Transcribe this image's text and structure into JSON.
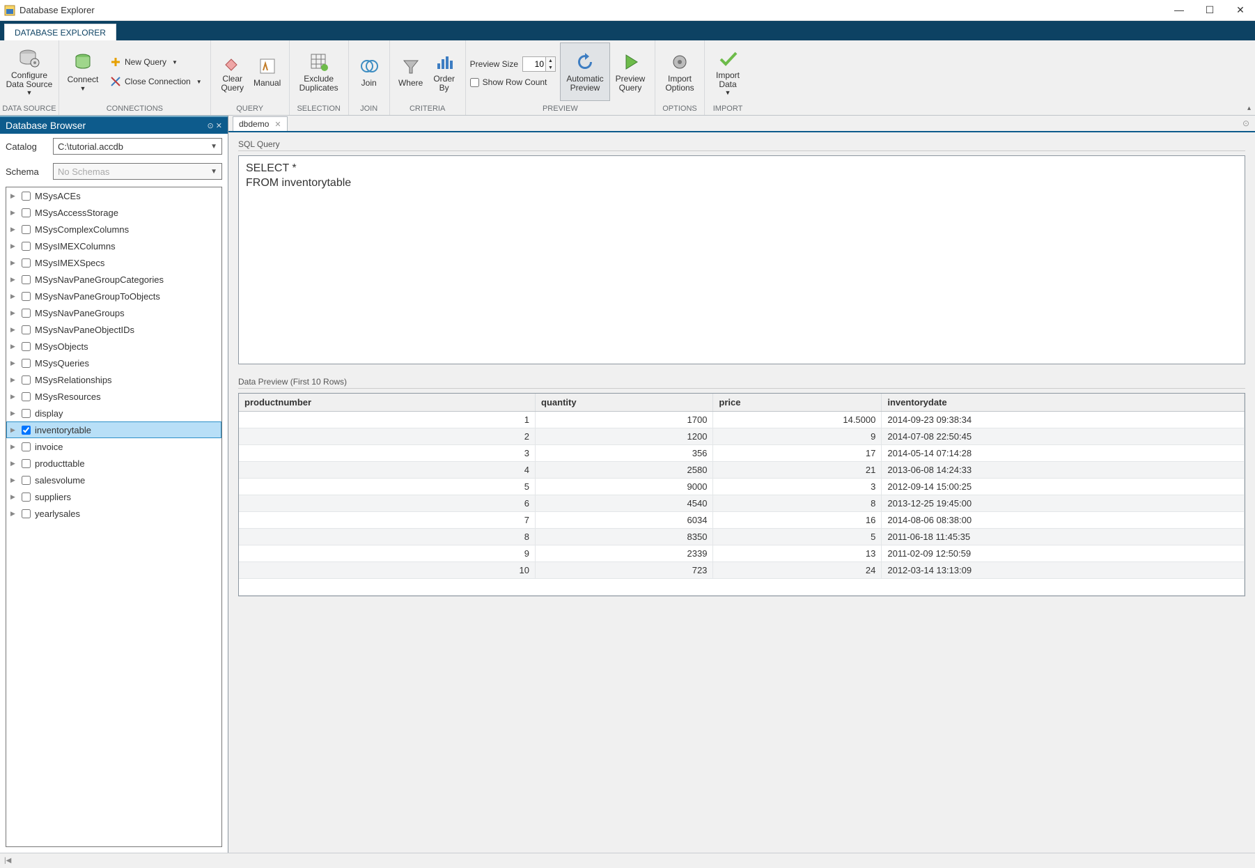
{
  "window": {
    "title": "Database Explorer"
  },
  "top_tab": {
    "label": "DATABASE EXPLORER"
  },
  "ribbon": {
    "groups": {
      "data_source": {
        "label": "DATA SOURCE",
        "configure": "Configure\nData Source"
      },
      "connections": {
        "label": "CONNECTIONS",
        "connect": "Connect",
        "new_query": "New Query",
        "close_conn": "Close Connection"
      },
      "query": {
        "label": "QUERY",
        "clear": "Clear\nQuery",
        "manual": "Manual"
      },
      "selection": {
        "label": "SELECTION",
        "exclude": "Exclude\nDuplicates"
      },
      "join": {
        "label": "JOIN",
        "join": "Join"
      },
      "criteria": {
        "label": "CRITERIA",
        "where": "Where",
        "orderby": "Order\nBy"
      },
      "preview": {
        "label": "PREVIEW",
        "size_label": "Preview Size",
        "size_value": "10",
        "row_count": "Show Row Count",
        "auto": "Automatic\nPreview",
        "preview_q": "Preview\nQuery"
      },
      "options": {
        "label": "OPTIONS",
        "import_opts": "Import\nOptions"
      },
      "import": {
        "label": "IMPORT",
        "import_data": "Import\nData"
      }
    }
  },
  "browser": {
    "title": "Database Browser",
    "catalog_label": "Catalog",
    "catalog_value": "C:\\tutorial.accdb",
    "schema_label": "Schema",
    "schema_placeholder": "No Schemas",
    "items": [
      {
        "label": "MSysACEs",
        "checked": false
      },
      {
        "label": "MSysAccessStorage",
        "checked": false
      },
      {
        "label": "MSysComplexColumns",
        "checked": false
      },
      {
        "label": "MSysIMEXColumns",
        "checked": false
      },
      {
        "label": "MSysIMEXSpecs",
        "checked": false
      },
      {
        "label": "MSysNavPaneGroupCategories",
        "checked": false
      },
      {
        "label": "MSysNavPaneGroupToObjects",
        "checked": false
      },
      {
        "label": "MSysNavPaneGroups",
        "checked": false
      },
      {
        "label": "MSysNavPaneObjectIDs",
        "checked": false
      },
      {
        "label": "MSysObjects",
        "checked": false
      },
      {
        "label": "MSysQueries",
        "checked": false
      },
      {
        "label": "MSysRelationships",
        "checked": false
      },
      {
        "label": "MSysResources",
        "checked": false
      },
      {
        "label": "display",
        "checked": false
      },
      {
        "label": "inventorytable",
        "checked": true,
        "selected": true
      },
      {
        "label": "invoice",
        "checked": false
      },
      {
        "label": "producttable",
        "checked": false
      },
      {
        "label": "salesvolume",
        "checked": false
      },
      {
        "label": "suppliers",
        "checked": false
      },
      {
        "label": "yearlysales",
        "checked": false
      }
    ]
  },
  "document": {
    "tab_label": "dbdemo",
    "sql_label": "SQL Query",
    "sql_text": "SELECT *\nFROM inventorytable",
    "preview_label": "Data Preview (First 10 Rows)",
    "columns": [
      "productnumber",
      "quantity",
      "price",
      "inventorydate"
    ],
    "rows": [
      {
        "productnumber": "1",
        "quantity": "1700",
        "price": "14.5000",
        "inventorydate": "2014-09-23 09:38:34"
      },
      {
        "productnumber": "2",
        "quantity": "1200",
        "price": "9",
        "inventorydate": "2014-07-08 22:50:45"
      },
      {
        "productnumber": "3",
        "quantity": "356",
        "price": "17",
        "inventorydate": "2014-05-14 07:14:28"
      },
      {
        "productnumber": "4",
        "quantity": "2580",
        "price": "21",
        "inventorydate": "2013-06-08 14:24:33"
      },
      {
        "productnumber": "5",
        "quantity": "9000",
        "price": "3",
        "inventorydate": "2012-09-14 15:00:25"
      },
      {
        "productnumber": "6",
        "quantity": "4540",
        "price": "8",
        "inventorydate": "2013-12-25 19:45:00"
      },
      {
        "productnumber": "7",
        "quantity": "6034",
        "price": "16",
        "inventorydate": "2014-08-06 08:38:00"
      },
      {
        "productnumber": "8",
        "quantity": "8350",
        "price": "5",
        "inventorydate": "2011-06-18 11:45:35"
      },
      {
        "productnumber": "9",
        "quantity": "2339",
        "price": "13",
        "inventorydate": "2011-02-09 12:50:59"
      },
      {
        "productnumber": "10",
        "quantity": "723",
        "price": "24",
        "inventorydate": "2012-03-14 13:13:09"
      }
    ]
  }
}
